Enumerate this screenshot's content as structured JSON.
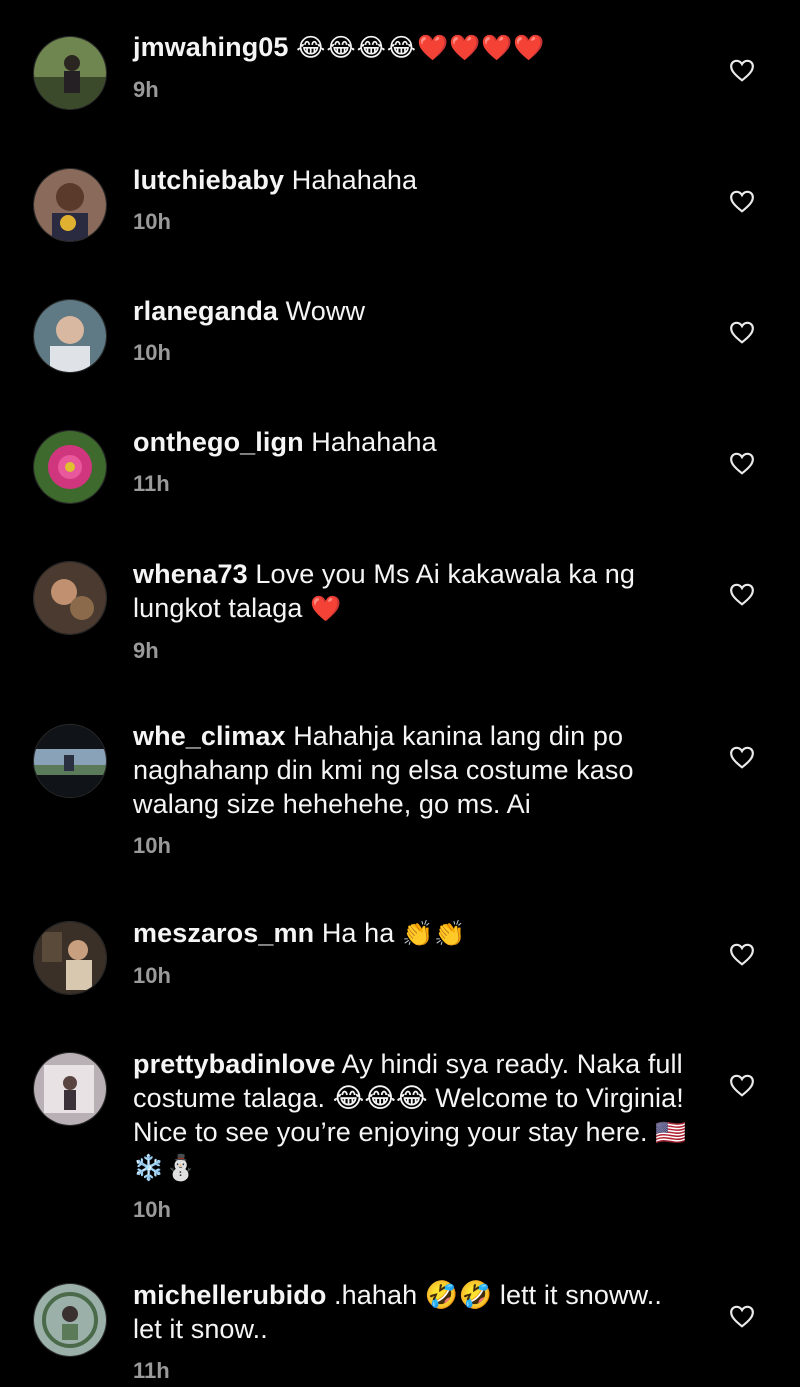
{
  "comments": [
    {
      "username": "jmwahing05",
      "text": "",
      "emoji": "😂😂😂😂❤️❤️❤️❤️",
      "time": "9h",
      "avatar_color": "#5a6f3e"
    },
    {
      "username": "lutchiebaby",
      "text": "Hahahaha",
      "emoji": "",
      "time": "10h",
      "avatar_color": "#7a4a3a"
    },
    {
      "username": "rlaneganda",
      "text": "Woww",
      "emoji": "",
      "time": "10h",
      "avatar_color": "#4f6a75"
    },
    {
      "username": "onthego_lign",
      "text": "Hahahaha",
      "emoji": "",
      "time": "11h",
      "avatar_color": "#c0367a"
    },
    {
      "username": "whena73",
      "text": "Love you Ms Ai kakawala ka ng lungkot talaga",
      "emoji": "❤️",
      "time": "9h",
      "avatar_color": "#6b5546"
    },
    {
      "username": "whe_climax",
      "text": "Hahahja kanina lang din po naghahanp din kmi ng elsa costume kaso walang size hehehehe, go ms. Ai",
      "emoji": "",
      "time": "10h",
      "avatar_color": "#3d5a72"
    },
    {
      "username": "meszaros_mn",
      "text": "Ha ha",
      "emoji": "👏👏",
      "time": "10h",
      "avatar_color": "#5b4a3b"
    },
    {
      "username": "prettybadinlove",
      "text": "Ay hindi sya ready. Naka full costume talaga. 😂😂😂 Welcome to Virginia! Nice to see you’re enjoying your stay here.",
      "emoji": "🇺🇸❄️⛄",
      "time": "10h",
      "avatar_color": "#9a8a8c"
    },
    {
      "username": "michellerubido",
      "text": ".hahah 🤣🤣 lett it snoww.. let it snow..",
      "emoji": "",
      "time": "11h",
      "avatar_color": "#6f8a6a"
    }
  ],
  "icons": {
    "like": "heart-outline-icon",
    "avatar": "user-avatar"
  },
  "colors": {
    "background": "#000000",
    "text": "#f5f5f5",
    "timestamp": "#9a9a9a"
  }
}
